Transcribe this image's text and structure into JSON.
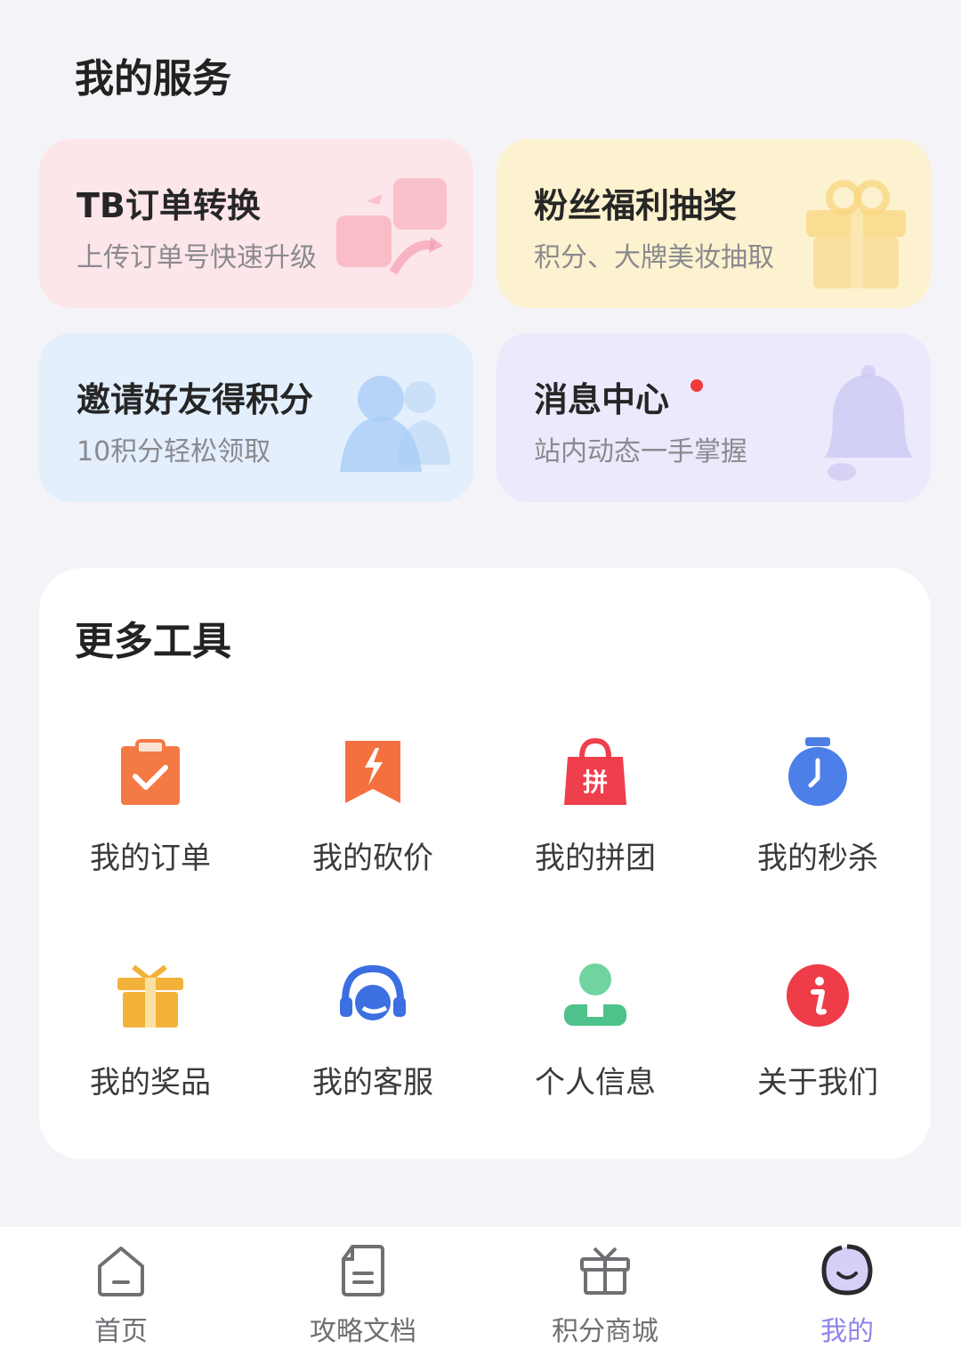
{
  "services": {
    "title": "我的服务",
    "cards": [
      {
        "title": "TB订单转换",
        "subtitle": "上传订单号快速升级",
        "bg_color": "#fde6ea",
        "icon": "exchange-icon"
      },
      {
        "title": "粉丝福利抽奖",
        "subtitle": "积分、大牌美妆抽取",
        "bg_color": "#fdf2cf",
        "icon": "gift-icon"
      },
      {
        "title": "邀请好友得积分",
        "subtitle": "10积分轻松领取",
        "bg_color": "#e3effd",
        "icon": "friends-icon"
      },
      {
        "title": "消息中心",
        "subtitle": "站内动态一手掌握",
        "bg_color": "#ebe9fb",
        "icon": "bell-icon",
        "has_unread_dot": true
      }
    ]
  },
  "tools": {
    "title": "更多工具",
    "items": [
      {
        "label": "我的订单",
        "icon": "clipboard-check-icon",
        "color": "#f47a45"
      },
      {
        "label": "我的砍价",
        "icon": "bargain-bolt-icon",
        "color": "#f5703f"
      },
      {
        "label": "我的拼团",
        "icon": "group-buy-bag-icon",
        "color": "#ef3e4c",
        "icon_text": "拼"
      },
      {
        "label": "我的秒杀",
        "icon": "stopwatch-icon",
        "color": "#4d7fe8"
      },
      {
        "label": "我的奖品",
        "icon": "prize-gift-icon",
        "color": "#f2b23a"
      },
      {
        "label": "我的客服",
        "icon": "headset-icon",
        "color": "#3b6fe2"
      },
      {
        "label": "个人信息",
        "icon": "person-icon",
        "color": "#4fc18a"
      },
      {
        "label": "关于我们",
        "icon": "info-icon",
        "color": "#ee3d48"
      }
    ]
  },
  "bottom_nav": {
    "items": [
      {
        "label": "首页",
        "icon": "home-icon"
      },
      {
        "label": "攻略文档",
        "icon": "document-icon"
      },
      {
        "label": "积分商城",
        "icon": "gift-box-icon"
      },
      {
        "label": "我的",
        "icon": "profile-face-icon",
        "active": true
      }
    ],
    "active_color": "#8f86e8"
  }
}
